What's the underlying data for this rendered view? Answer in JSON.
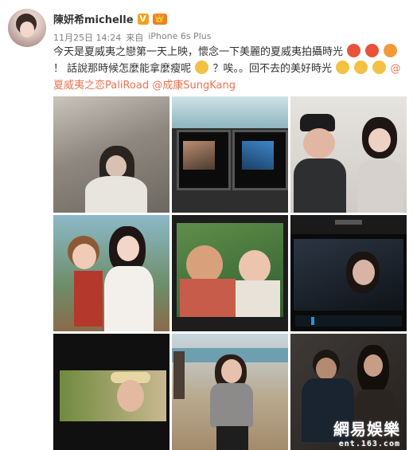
{
  "user": {
    "name": "陳妍希michelle",
    "verified_badge": "V",
    "level_badge": "💛"
  },
  "meta": {
    "date": "11月25日 14:24",
    "source_prefix": "来自",
    "source_device": "iPhone 6s Plus"
  },
  "post": {
    "text_1": "今天是夏威夷之戀第一天上映，懷念一下美麗的夏威夷拍攝時光",
    "text_2": "！",
    "text_3": "話說那時候怎麼能拿麼瘦呢",
    "text_4": "？唉。。回不去的美好時光",
    "mention_1": "@夏威夷之恋PaliRoad",
    "mention_2": "@成康SungKang"
  },
  "photos": [
    {
      "label": "beach-scene"
    },
    {
      "label": "monitors-on-set"
    },
    {
      "label": "director-and-actress"
    },
    {
      "label": "actress-with-boy"
    },
    {
      "label": "monitor-couple-scene"
    },
    {
      "label": "editing-screen"
    },
    {
      "label": "screen-flower-crown"
    },
    {
      "label": "beach-walk"
    },
    {
      "label": "night-scene"
    }
  ],
  "watermark": {
    "main": "網易娛樂",
    "url": "ent.163.com"
  }
}
